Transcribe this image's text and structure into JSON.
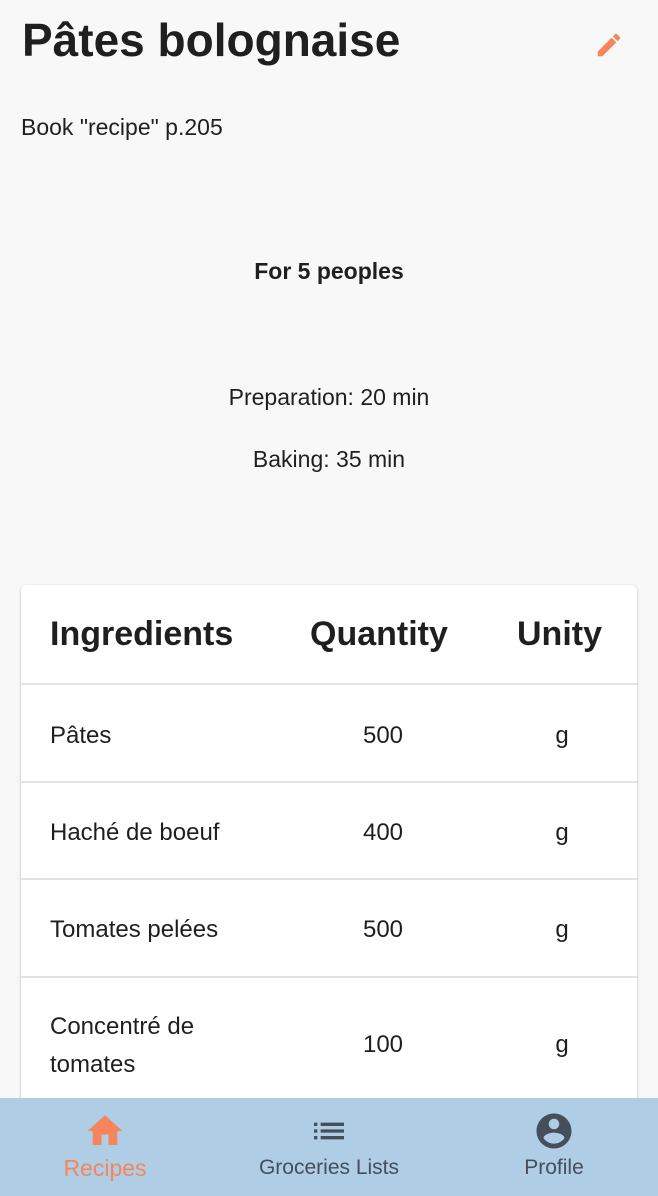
{
  "recipe": {
    "title": "Pâtes bolognaise",
    "source": "Book \"recipe\" p.205",
    "servings": "For 5 peoples",
    "preparation": "Preparation: 20 min",
    "baking": "Baking: 35 min"
  },
  "header": {
    "edit_icon": "pencil-icon"
  },
  "table": {
    "headers": [
      "Ingredients",
      "Quantity",
      "Unity"
    ],
    "rows": [
      {
        "ingredient": "Pâtes",
        "quantity": "500",
        "unit": "g"
      },
      {
        "ingredient": "Haché de boeuf",
        "quantity": "400",
        "unit": "g"
      },
      {
        "ingredient": "Tomates pelées",
        "quantity": "500",
        "unit": "g"
      },
      {
        "ingredient": "Concentré de tomates",
        "quantity": "100",
        "unit": "g"
      }
    ]
  },
  "nav": {
    "items": [
      {
        "label": "Recipes",
        "icon": "home-icon",
        "active": true
      },
      {
        "label": "Groceries Lists",
        "icon": "list-icon",
        "active": false
      },
      {
        "label": "Profile",
        "icon": "account-circle-icon",
        "active": false
      }
    ]
  },
  "colors": {
    "accent": "#f4855d",
    "nav_background": "#b0cde6",
    "nav_inactive": "#454f5a",
    "page_background": "#f8f8f8"
  }
}
